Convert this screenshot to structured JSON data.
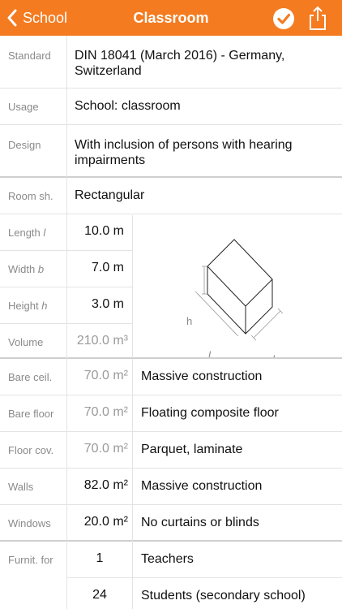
{
  "nav": {
    "back_label": "School",
    "title": "Classroom"
  },
  "info": {
    "standard_label": "Standard",
    "standard_value": "DIN 18041 (March 2016) - Germany, Switzerland",
    "usage_label": "Usage",
    "usage_value": "School: classroom",
    "design_label": "Design",
    "design_value": "With inclusion of persons with hearing impairments"
  },
  "room": {
    "shape_label": "Room sh.",
    "shape_value": "Rectangular",
    "length_label": "Length",
    "length_symbol": "l",
    "length_value": "10.0 m",
    "width_label": "Width",
    "width_symbol": "b",
    "width_value": "7.0 m",
    "height_label": "Height",
    "height_symbol": "h",
    "height_value": "3.0 m",
    "volume_label": "Volume",
    "volume_value": "210.0 m³",
    "diagram_h": "h",
    "diagram_l": "l",
    "diagram_b": "b"
  },
  "surfaces": [
    {
      "label": "Bare ceil.",
      "area": "70.0 m²",
      "area_gray": true,
      "material": "Massive construction"
    },
    {
      "label": "Bare floor",
      "area": "70.0 m²",
      "area_gray": true,
      "material": "Floating composite floor"
    },
    {
      "label": "Floor cov.",
      "area": "70.0 m²",
      "area_gray": true,
      "material": "Parquet, laminate"
    },
    {
      "label": "Walls",
      "area": "82.0 m²",
      "area_gray": false,
      "material": "Massive construction"
    },
    {
      "label": "Windows",
      "area": "20.0 m²",
      "area_gray": false,
      "material": "No curtains or blinds"
    }
  ],
  "furniture": {
    "label": "Furnit. for",
    "items": [
      {
        "count": "1",
        "desc": "Teachers"
      },
      {
        "count": "24",
        "desc": "Students (secondary school)"
      }
    ]
  },
  "colors": {
    "accent": "#f47b20"
  }
}
